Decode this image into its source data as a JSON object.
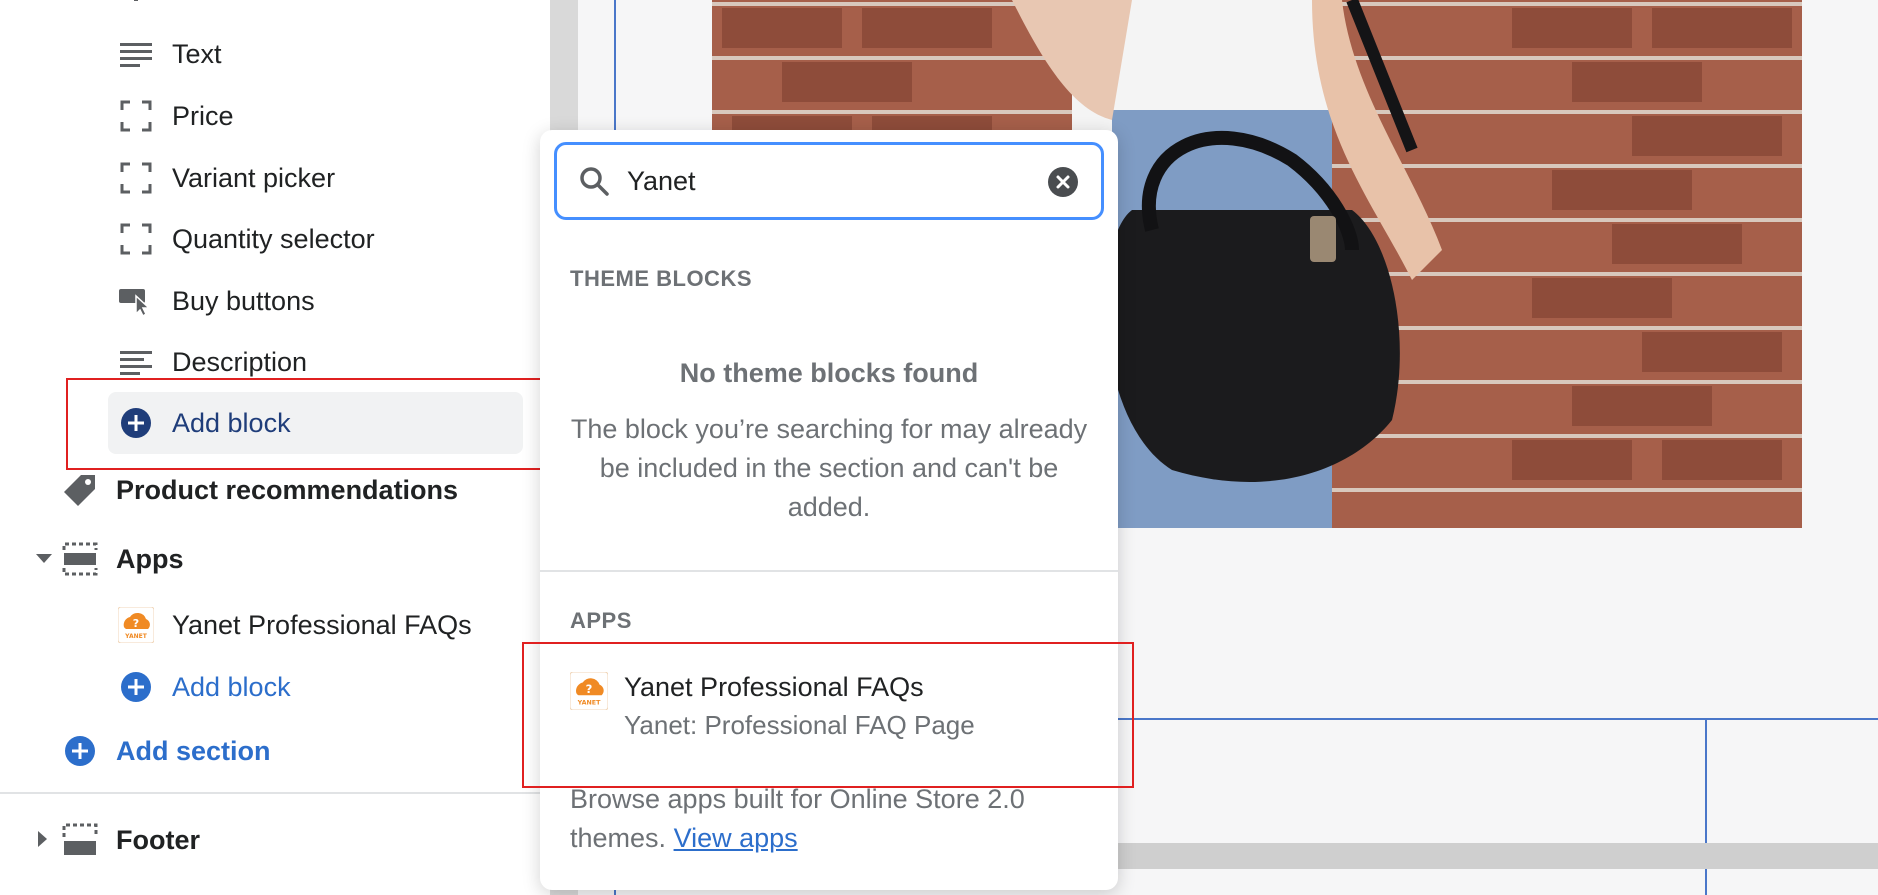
{
  "sidebar": {
    "blocks": [
      {
        "label": "Text",
        "icon": "text-lines-icon"
      },
      {
        "label": "Price",
        "icon": "dashed-frame-icon"
      },
      {
        "label": "Variant picker",
        "icon": "dashed-frame-icon"
      },
      {
        "label": "Quantity selector",
        "icon": "dashed-frame-icon"
      },
      {
        "label": "Buy buttons",
        "icon": "buy-button-icon"
      },
      {
        "label": "Description",
        "icon": "text-lines-icon"
      }
    ],
    "add_block_label": "Add block",
    "product_recommendations_label": "Product recommendations",
    "apps_section_label": "Apps",
    "apps_block_label": "Yanet Professional FAQs",
    "apps_add_block_label": "Add block",
    "add_section_label": "Add section",
    "footer_label": "Footer"
  },
  "popover": {
    "search_value": "Yanet",
    "theme_blocks_heading": "THEME BLOCKS",
    "empty_title": "No theme blocks found",
    "empty_body": "The block you’re searching for may already be included in the section and can't be added.",
    "apps_heading": "APPS",
    "app_title": "Yanet Professional FAQs",
    "app_subtitle": "Yanet: Professional FAQ Page",
    "browse_text": "Browse apps built for Online Store 2.0 themes.",
    "view_apps_link": "View apps"
  },
  "colors": {
    "accent_blue": "#2c6ecb",
    "focus_blue": "#458fff",
    "highlight_red": "#e02020",
    "yanet_orange": "#f08a24"
  }
}
